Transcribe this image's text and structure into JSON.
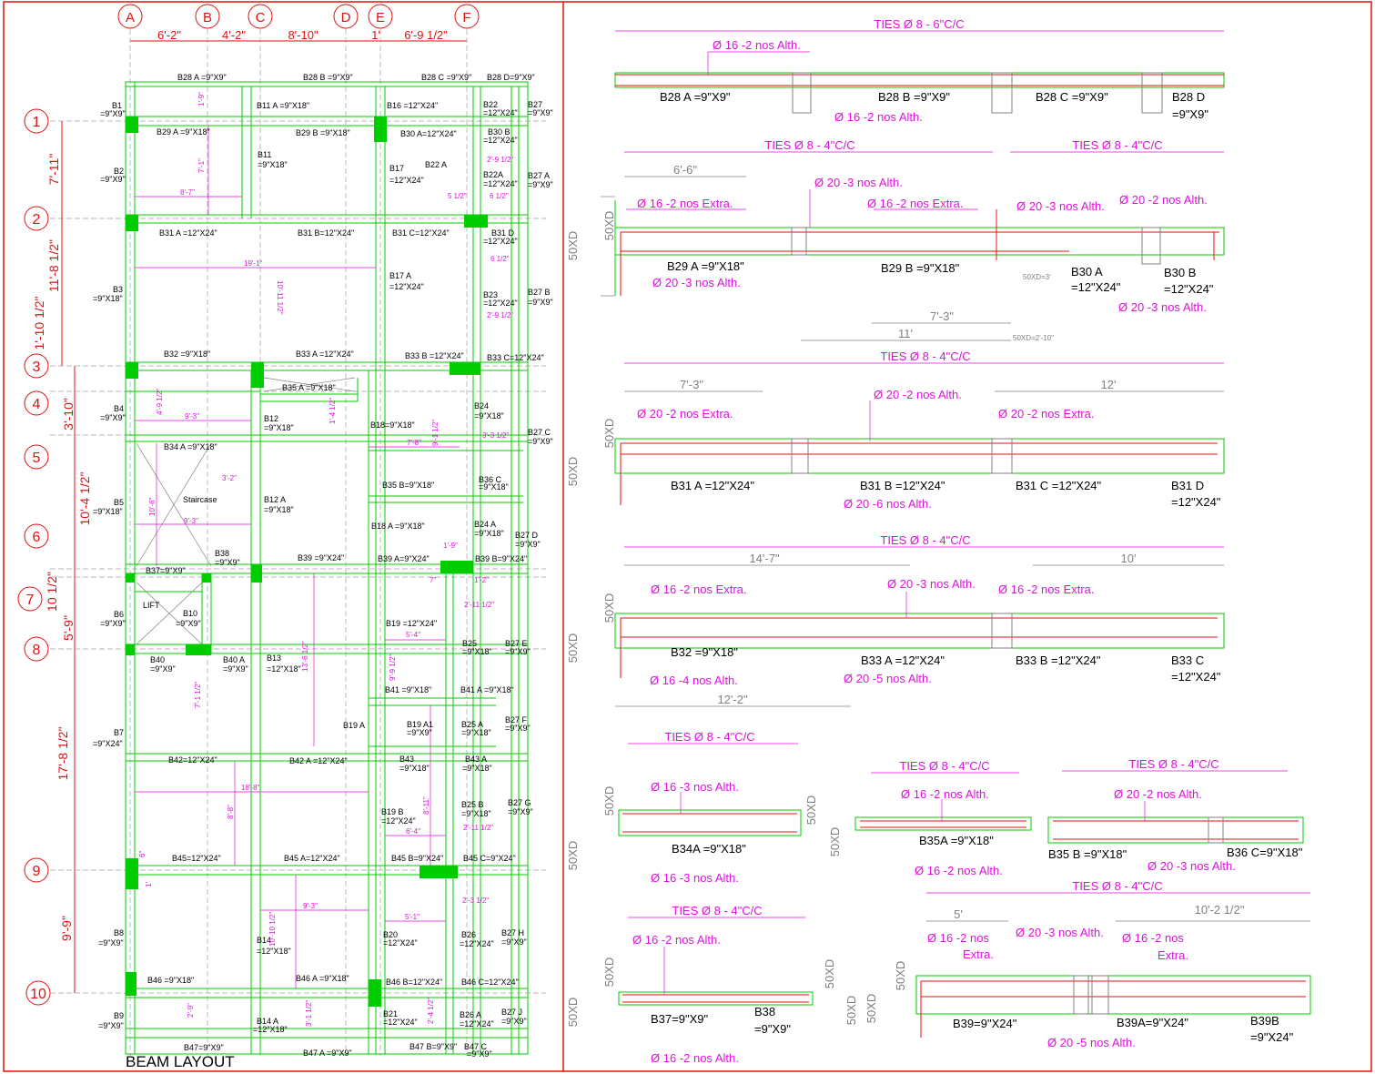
{
  "layout_title": "BEAM LAYOUT",
  "colors": {
    "green": "#00cc00",
    "red": "#e01010",
    "magenta": "#e010e0",
    "gray": "#808080",
    "black": "#000000"
  },
  "grid_columns": [
    "A",
    "B",
    "C",
    "D",
    "E",
    "F"
  ],
  "grid_rows": [
    "1",
    "2",
    "3",
    "4",
    "5",
    "6",
    "7",
    "8",
    "9",
    "10"
  ],
  "column_dims": [
    "6'-2\"",
    "4'-2\"",
    "8'-10\"",
    "1'",
    "6'-9 1/2\""
  ],
  "row_dims": [
    "7'-11\"",
    "11'-8 1/2\"",
    "1'-10 1/2\"",
    "3'-10\"",
    "10'-4 1/2\"",
    "10 1/2\"",
    "5'-9\"",
    "17'-8 1/2\"",
    "9'-9\""
  ],
  "plan_labels": {
    "b28a": "B28 A =9\"X9\"",
    "b28b": "B28 B =9\"X9\"",
    "b28c": "B28 C =9\"X9\"",
    "b28d": "B28 D=9\"X9\"",
    "b1": "B1",
    "b1s": "=9\"X9\"",
    "b11a": "B11 A =9\"X18\"",
    "b16": "B16 =12\"X24\"",
    "b22": "B22",
    "b22s": "=12\"X24\"",
    "b27": "B27",
    "b27s": "=9\"X9\"",
    "b29a": "B29 A =9\"X18\"",
    "b29b": "B29 B =9\"X18\"",
    "b30a": "B30 A=12\"X24\"",
    "b30b": "B30 B",
    "b30bs": "=12\"X24\"",
    "b11": "B11",
    "b11s": "=9\"X18\"",
    "b2": "B2",
    "b2s": "=9\"X9\"",
    "b17": "B17",
    "b17s": "=12\"X24\"",
    "b22a_t": "B22 A",
    "b22a": "B22A",
    "b22as": "=12\"X24\"",
    "b27a": "B27 A",
    "b27as": "=9\"X9\"",
    "b31a": "B31 A =12\"X24\"",
    "b31b": "B31 B=12\"X24\"",
    "b31c": "B31 C=12\"X24\"",
    "b31d": "B31 D",
    "b31ds": "=12\"X24\"",
    "b3": "B3",
    "b3s": "=9\"X18\"",
    "b17a": "B17 A",
    "b17as": "=12\"X24\"",
    "b23": "B23",
    "b23s": "=12\"X24\"",
    "b27b": "B27 B",
    "b27bs": "=9\"X9\"",
    "b32": "B32 =9\"X18\"",
    "b33a": "B33 A =12\"X24\"",
    "b33b": "B33 B =12\"X24\"",
    "b33c": "B33 C=12\"X24\"",
    "b35a": "B35 A =9\"X18\"",
    "b4": "B4",
    "b4s": "=9\"X9\"",
    "b12": "B12",
    "b12s": "=9\"X18\"",
    "b18": "B18=9\"X18\"",
    "b24": "B24",
    "b24s": "=9\"X18\"",
    "b27c": "B27 C",
    "b27cs": "=9\"X9\"",
    "b34a": "B34 A =9\"X18\"",
    "staircase": "Staircase",
    "b5": "B5",
    "b5s": "=9\"X18\"",
    "b12a": "B12 A",
    "b12as": "=9\"X18\"",
    "b35b": "B35 B=9\"X18\"",
    "b36c": "B36 C",
    "b36cs": "=9\"X18\"",
    "b18a": "B18 A =9\"X18\"",
    "b24a": "B24 A",
    "b24as": "=9\"X18\"",
    "b27d": "B27 D",
    "b27ds": "=9\"X9\"",
    "b38": "B38",
    "b38s": "=9\"X9\"",
    "b39": "B39 =9\"X24\"",
    "b39a": "B39 A=9\"X24\"",
    "b39b": "B39 B=9\"X24\"",
    "b37": "B37=9\"X9\"",
    "lift": "LIFT",
    "b6": "B6",
    "b6s": "=9\"X9\"",
    "b10": "B10",
    "b10s": "=9\"X9\"",
    "b19": "B19 =12\"X24\"",
    "b25": "B25",
    "b25s": "=9\"X18\"",
    "b27e": "B27 E",
    "b27es": "=9\"X9\"",
    "b40": "B40",
    "b40s": "=9\"X9\"",
    "b40a": "B40 A",
    "b40as": "=9\"X9\"",
    "b13": "B13",
    "b13s": "=12\"X18\"",
    "b41": "B41 =9\"X18\"",
    "b41a": "B41 A =9\"X18\"",
    "b19a": "B19 A",
    "b19a1": "B19 A1",
    "b19a1s": "=9\"X9\"",
    "b25a": "B25 A",
    "b25as": "=9\"X18\"",
    "b27f": "B27 F",
    "b27fs": "=9\"X9\"",
    "b7": "B7",
    "b7s": "=9\"X24\"",
    "b42": "B42=12\"X24\"",
    "b42a": "B42 A =12\"X24\"",
    "b43": "B43",
    "b43s": "=9\"X18\"",
    "b43a": "B43 A",
    "b43as": "=9\"X18\"",
    "b19b": "B19 B",
    "b19bs": "=12\"X24\"",
    "b25b": "B25 B",
    "b25bs": "=9\"X18\"",
    "b27g": "B27 G",
    "b27gs": "=9\"X9\"",
    "b45": "B45=12\"X24\"",
    "b45a": "B45 A=12\"X24\"",
    "b45b": "B45 B=9\"X24\"",
    "b45c": "B45 C=9\"X24\"",
    "b8": "B8",
    "b8s": "=9\"X9\"",
    "b14": "B14",
    "b14s": "=12\"X18\"",
    "b20": "B20",
    "b20s": "=12\"X24\"",
    "b26": "B26",
    "b26s": "=12\"X24\"",
    "b27h": "B27 H",
    "b27hs": "=9\"X9\"",
    "b46": "B46 =9\"X18\"",
    "b46a": "B46  A =9\"X18\"",
    "b46b": "B46 B=12\"X24\"",
    "b46c": "B46 C=12\"X24\"",
    "b9": "B9",
    "b9s": "=9\"X9\"",
    "b14a": "B14 A",
    "b14as": "=12\"X18\"",
    "b21": "B21",
    "b21s": "=12\"X24\"",
    "b26a": "B26 A",
    "b26as": "=12\"X24\"",
    "b27j": "B27 J",
    "b27js": "=9\"X9\"",
    "b47": "B47=9\"X9\"",
    "b47a": "B47 A =9\"X9\"",
    "b47b": "B47 B=9\"X9\"",
    "b47c": "B47 C",
    "b47cs": "=9\"X9\""
  },
  "plan_dims": {
    "d1": "1'-9\"",
    "d2": "7'-1\"",
    "d3": "8'-7\"",
    "d4": "2'-9 1/2\"",
    "d5": "5 1/2\"",
    "d6": "6 1/2\"",
    "d7": "19'-1\"",
    "d8": "10'-11 1/2\"",
    "d9": "6 1/2\"",
    "d10": "2'-9 1/2\"",
    "d11": "4'-9 1/2\"",
    "d12": "9'-3\"",
    "d13": "1'-4 1/2\"",
    "d14": "7'-8\"",
    "d15": "9'-1 1/2\"",
    "d16": "3'-3 1/2\"",
    "d17": "3'-2\"",
    "d18": "10'-6\"",
    "d19": "9'-3\"",
    "d20": "1'-9\"",
    "d21": "7\"",
    "d22": "1'-2\"",
    "d23": "2'-11 1/2\"",
    "d24": "5'-4\"",
    "d25": "13'-6 1/2\"",
    "d26": "9'-9 1/2\"",
    "d27": "7'-1 1/2\"",
    "d28": "18'-8\"",
    "d29": "8'-8\"",
    "d30": "8'-11\"",
    "d31": "6'-4\"",
    "d32": "2'-11 1/2\"",
    "d33": "9'-3\"",
    "d34": "10'-10 1/2\"",
    "d35": "5'-1\"",
    "d36": "2'-3 1/2\"",
    "d37": "2'-9\"",
    "d38": "3'-1 1/2\"",
    "d39": "2'-4 1/2\"",
    "d40": "6\"",
    "d41": "1'"
  },
  "details": {
    "s1": {
      "ties": "TIES Ø 8 - 6\"C/C",
      "top": "Ø 16 -2 nos Alth.",
      "bot": "Ø 16 -2 nos Alth.",
      "b28a": "B28 A =9\"X9\"",
      "b28b": "B28 B =9\"X9\"",
      "b28c": "B28 C =9\"X9\"",
      "b28d": "B28 D",
      "b28ds": "=9\"X9\""
    },
    "s2": {
      "ties1": "TIES Ø 8 - 4\"C/C",
      "ties2": "TIES Ø 8 - 4\"C/C",
      "dim1": "6'-6\"",
      "top_alth": "Ø 20 -3 nos Alth.",
      "extra1": "Ø 16 -2 nos Extra.",
      "extra2": "Ø 16 -2 nos Extra.",
      "alth2": "Ø 20 -3 nos Alth.",
      "alth3": "Ø 20 -2 nos Alth.",
      "b29a": "B29 A =9\"X18\"",
      "bot1": "Ø 20 -3 nos Alth.",
      "b29b": "B29 B =9\"X18\"",
      "b30a": "B30 A",
      "b30as": "=12\"X24\"",
      "b30b": "B30 B",
      "b30bs": "=12\"X24\"",
      "bot2": "Ø 20 -3 nos Alth.",
      "dim2": "7'-3\"",
      "dim3": "11'",
      "dim4": "50XD=3'",
      "dim5": "50XD=2'-10\"",
      "xd1": "50XD",
      "xd2": "50XD"
    },
    "s3": {
      "ties": "TIES Ø 8 - 4\"C/C",
      "dim1": "7'-3\"",
      "dim2": "12'",
      "alth": "Ø 20 -2 nos Alth.",
      "extra1": "Ø 20 -2 nos Extra.",
      "extra2": "Ø 20 -2 nos Extra.",
      "b31a": "B31 A =12\"X24\"",
      "b31b": "B31 B =12\"X24\"",
      "b31c": "B31 C =12\"X24\"",
      "b31d": "B31 D",
      "b31ds": "=12\"X24\"",
      "bot": "Ø 20 -6 nos Alth.",
      "xd1": "50XD",
      "xd2": "50XD"
    },
    "s4": {
      "ties": "TIES Ø 8 - 4\"C/C",
      "dim1": "14'-7\"",
      "dim2": "10'",
      "alth": "Ø 20 -3 nos Alth.",
      "extra1": "Ø 16 -2 nos Extra.",
      "extra2": "Ø 16 -2 nos Extra.",
      "b32": "B32 =9\"X18\"",
      "b33a": "B33 A =12\"X24\"",
      "b33b": "B33 B =12\"X24\"",
      "b33c": "B33 C",
      "b33cs": "=12\"X24\"",
      "bot1": "Ø 16 -4 nos Alth.",
      "bot2": "Ø 20 -5 nos Alth.",
      "dim3": "12'-2\"",
      "xd1": "50XD",
      "xd2": "50XD"
    },
    "s5": {
      "ties": "TIES Ø 8 - 4\"C/C",
      "top": "Ø 16 -3 nos Alth.",
      "name": "B34A =9\"X18\"",
      "bot": "Ø 16 -3 nos Alth.",
      "xd1": "50XD",
      "xd2": "50XD",
      "xd3": "50XD",
      "xd4": "50XD"
    },
    "s6": {
      "ties": "TIES Ø 8 - 4\"C/C",
      "top": "Ø 16 -2 nos Alth.",
      "name": "B35A =9\"X18\"",
      "bot": "Ø 16 -2 nos Alth."
    },
    "s7": {
      "ties": "TIES Ø 8 - 4\"C/C",
      "top": "Ø 20 -2 nos Alth.",
      "name1": "B35 B =9\"X18\"",
      "name2": "B36 C=9\"X18\"",
      "bot": "Ø 20 -3 nos Alth."
    },
    "s8": {
      "ties": "TIES Ø 8 - 4\"C/C",
      "top": "Ø 16 -2 nos Alth.",
      "name1": "B37=9\"X9\"",
      "name2": "B38",
      "name2s": "=9\"X9\"",
      "bot": "Ø 16 -2 nos Alth.",
      "xd1": "50XD",
      "xd2": "50XD",
      "xd3": "50XD",
      "xd4": "50XD"
    },
    "s9": {
      "ties": "TIES Ø 8 - 4\"C/C",
      "dim1": "5'",
      "dim2": "10'-2 1/2\"",
      "extra1": "Ø 16 -2 nos",
      "extra1b": "Extra.",
      "alth": "Ø 20 -3 nos Alth.",
      "extra2": "Ø 16 -2 nos",
      "extra2b": "Extra.",
      "b39": "B39=9\"X24\"",
      "b39a": "B39A=9\"X24\"",
      "b39b": "B39B",
      "b39bs": "=9\"X24\"",
      "bot": "Ø 20 -5 nos Alth.",
      "xd1": "50XD",
      "xd2": "50XD"
    }
  }
}
